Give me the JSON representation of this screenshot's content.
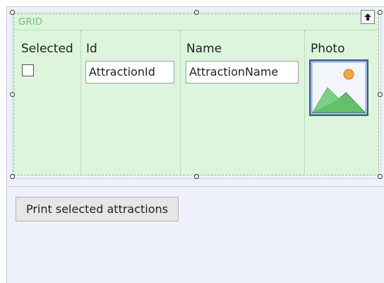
{
  "grid": {
    "label": "GRID",
    "columns": [
      {
        "title": "Selected"
      },
      {
        "title": "Id",
        "field_value": "AttractionId"
      },
      {
        "title": "Name",
        "field_value": "AttractionName"
      },
      {
        "title": "Photo",
        "icon": "image-placeholder-icon"
      }
    ],
    "upload_icon": "arrow-up-icon"
  },
  "actions": {
    "print_label": "Print selected attractions"
  },
  "colors": {
    "grid_background": "#dcf5dc",
    "grid_border": "#7fc98a",
    "form_background": "#eef1fb"
  }
}
